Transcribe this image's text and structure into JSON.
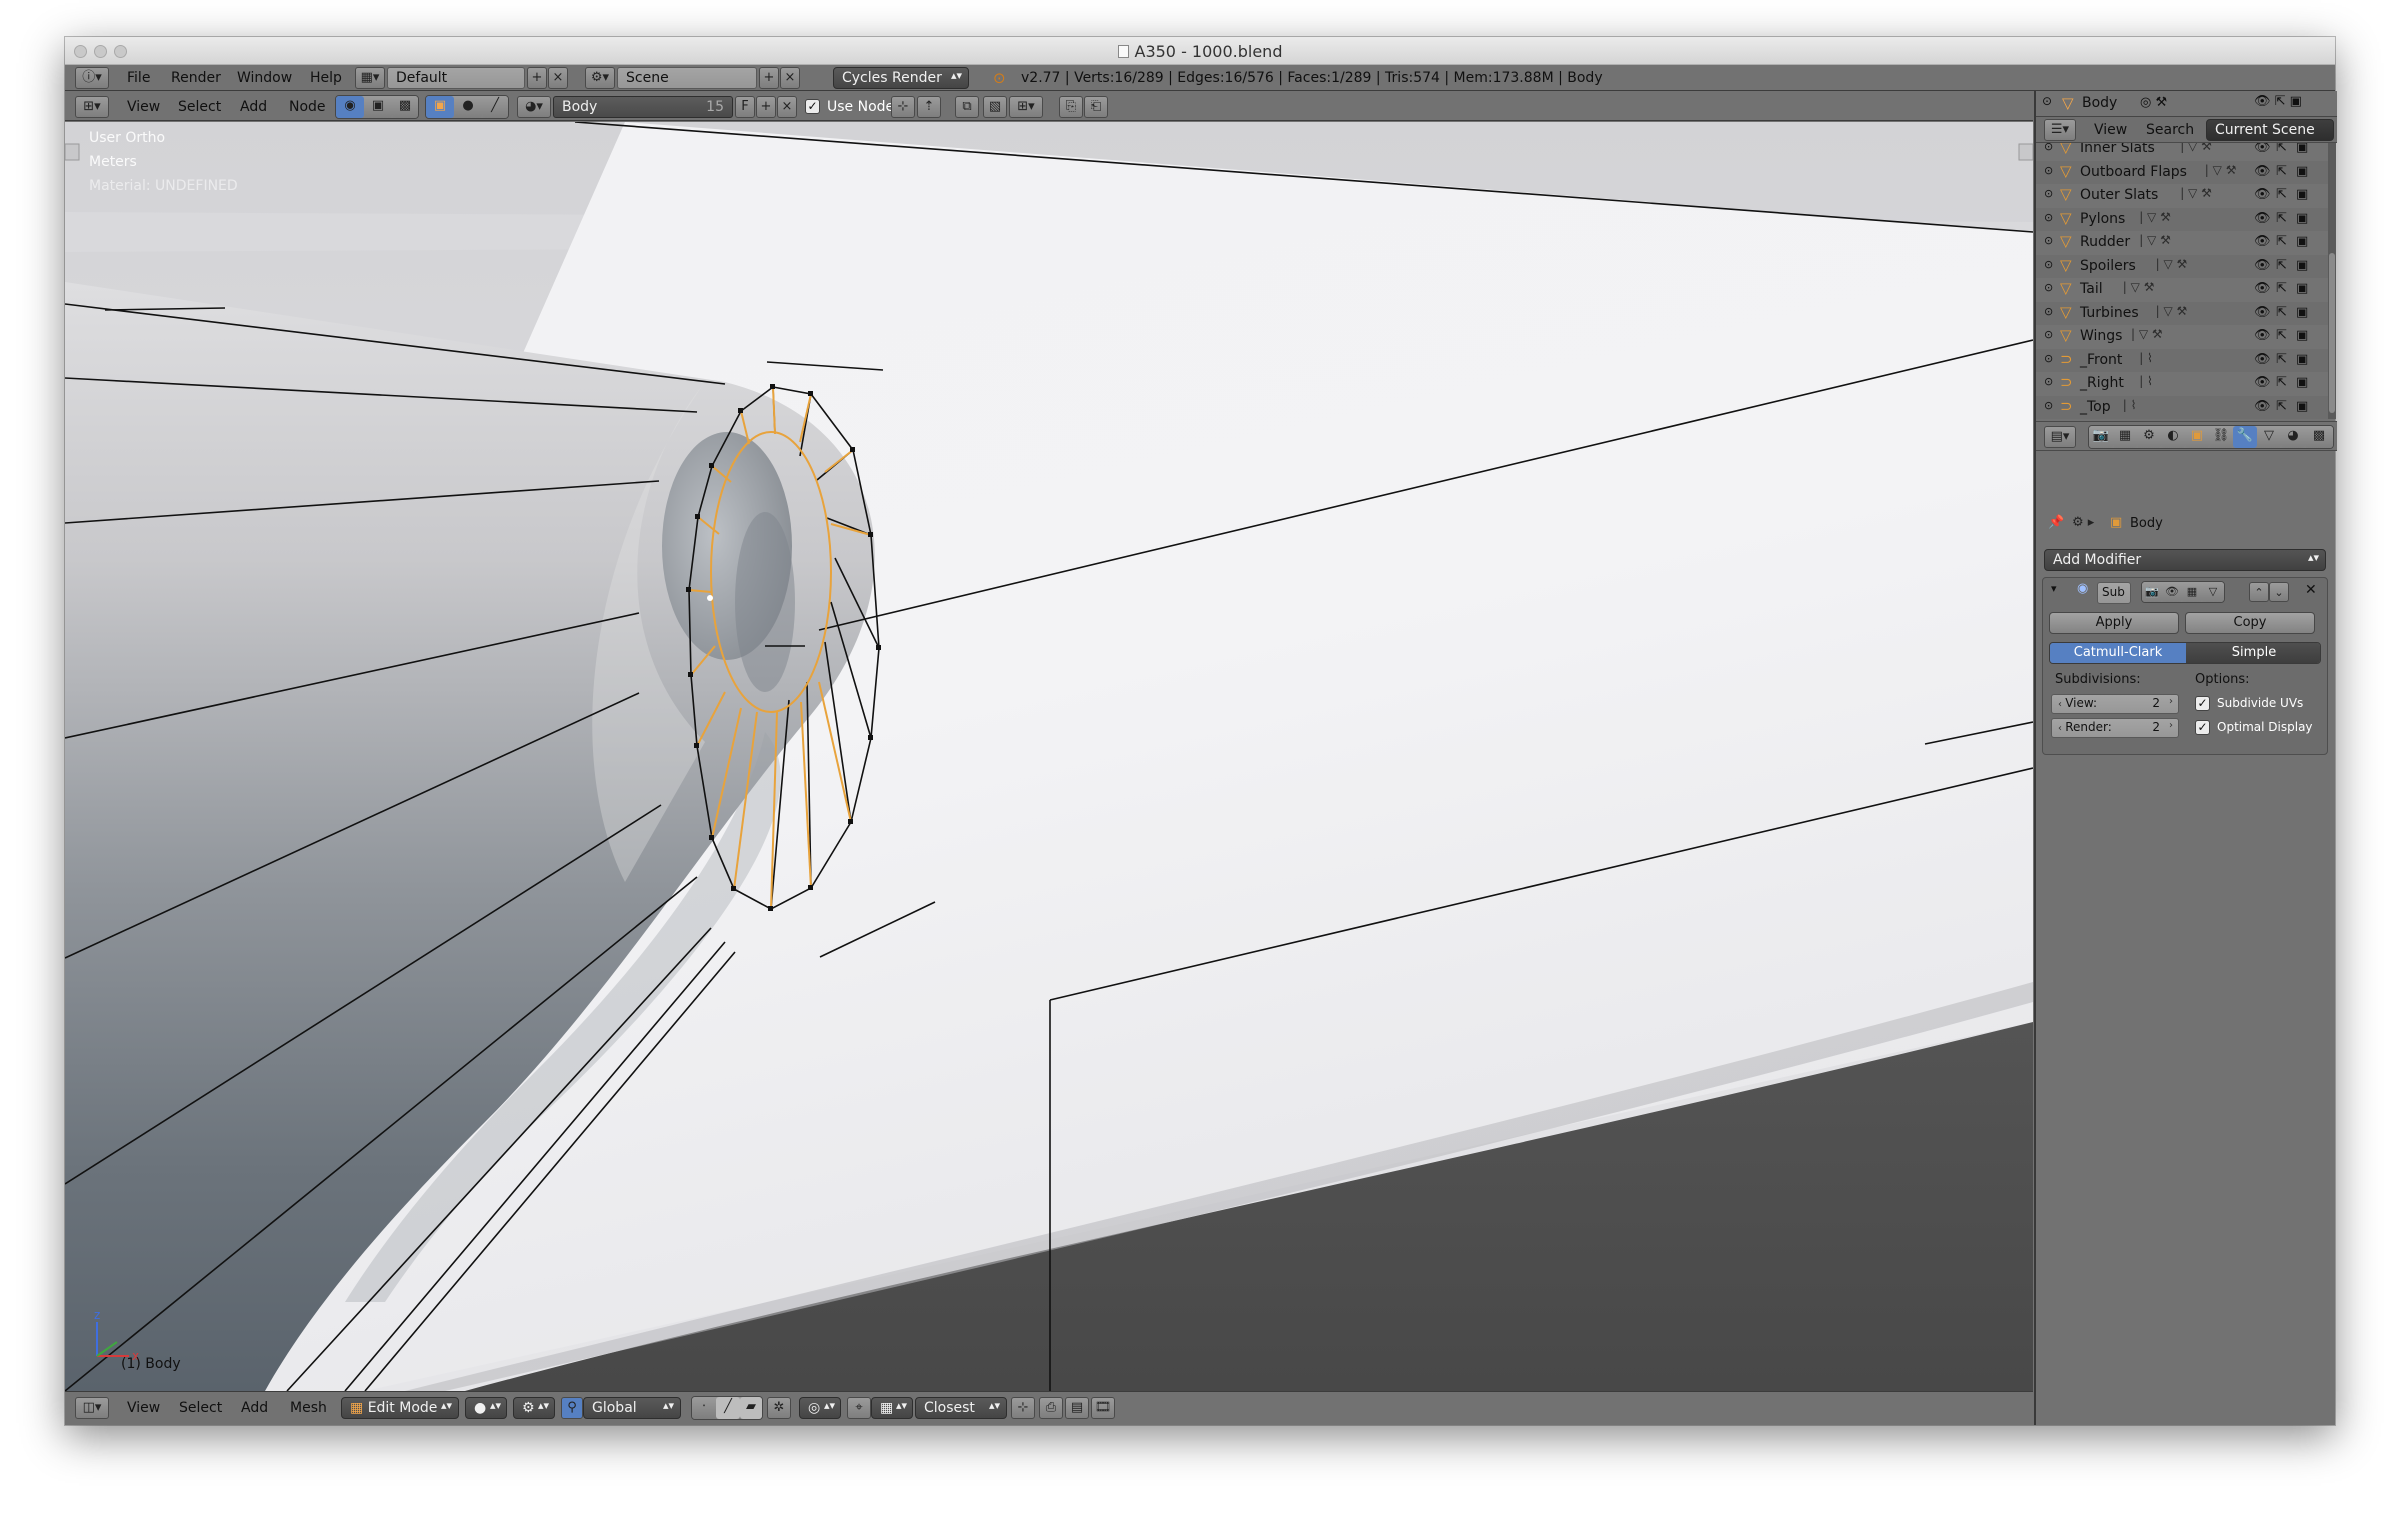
{
  "window": {
    "title": "A350 - 1000.blend"
  },
  "info_header": {
    "menus": [
      "File",
      "Render",
      "Window",
      "Help"
    ],
    "screen_layout": "Default",
    "scene": "Scene",
    "render_engine": "Cycles Render",
    "stats": "v2.77 | Verts:16/289 | Edges:16/576 | Faces:1/289 | Tris:574 | Mem:173.88M | Body"
  },
  "node_header": {
    "menus": [
      "View",
      "Select",
      "Add",
      "Node"
    ],
    "material_name": "Body",
    "user_count": "15",
    "fake_user": "F",
    "use_nodes_label": "Use Nodes",
    "use_nodes_checked": true
  },
  "viewport": {
    "view_name": "User Ortho",
    "units": "Meters",
    "material_info": "Material: UNDEFINED",
    "object_label": "(1) Body",
    "background_light": "#dcdcdf",
    "body_shadow": "#4a4a4a",
    "selection_color": "#e8a33c"
  },
  "bottom_header": {
    "menus": [
      "View",
      "Select",
      "Add",
      "Mesh"
    ],
    "mode": "Edit Mode",
    "orientation": "Global",
    "snap_target": "Closest"
  },
  "outliner": {
    "active_object": "Body",
    "view_label": "View",
    "search_label": "Search",
    "filter": "Current Scene",
    "items": [
      {
        "name": "Inner Slats",
        "type": "mesh"
      },
      {
        "name": "Outboard Flaps",
        "type": "mesh"
      },
      {
        "name": "Outer Slats",
        "type": "mesh"
      },
      {
        "name": "Pylons",
        "type": "mesh"
      },
      {
        "name": "Rudder",
        "type": "mesh"
      },
      {
        "name": "Spoilers",
        "type": "mesh"
      },
      {
        "name": "Tail",
        "type": "mesh"
      },
      {
        "name": "Turbines",
        "type": "mesh"
      },
      {
        "name": "Wings",
        "type": "mesh"
      },
      {
        "name": "_Front",
        "type": "curve"
      },
      {
        "name": "_Right",
        "type": "curve"
      },
      {
        "name": "_Top",
        "type": "curve"
      }
    ]
  },
  "properties": {
    "breadcrumb_object": "Body",
    "add_modifier_label": "Add Modifier",
    "modifier": {
      "name": "Sub",
      "apply_label": "Apply",
      "copy_label": "Copy",
      "algorithms": [
        "Catmull-Clark",
        "Simple"
      ],
      "active_algorithm": "Catmull-Clark",
      "subdivisions_label": "Subdivisions:",
      "options_label": "Options:",
      "view_label": "View:",
      "view_value": "2",
      "render_label": "Render:",
      "render_value": "2",
      "subdivide_uvs_label": "Subdivide UVs",
      "subdivide_uvs": true,
      "optimal_display_label": "Optimal Display",
      "optimal_display": true
    },
    "accent_blue": "#5680c2"
  }
}
